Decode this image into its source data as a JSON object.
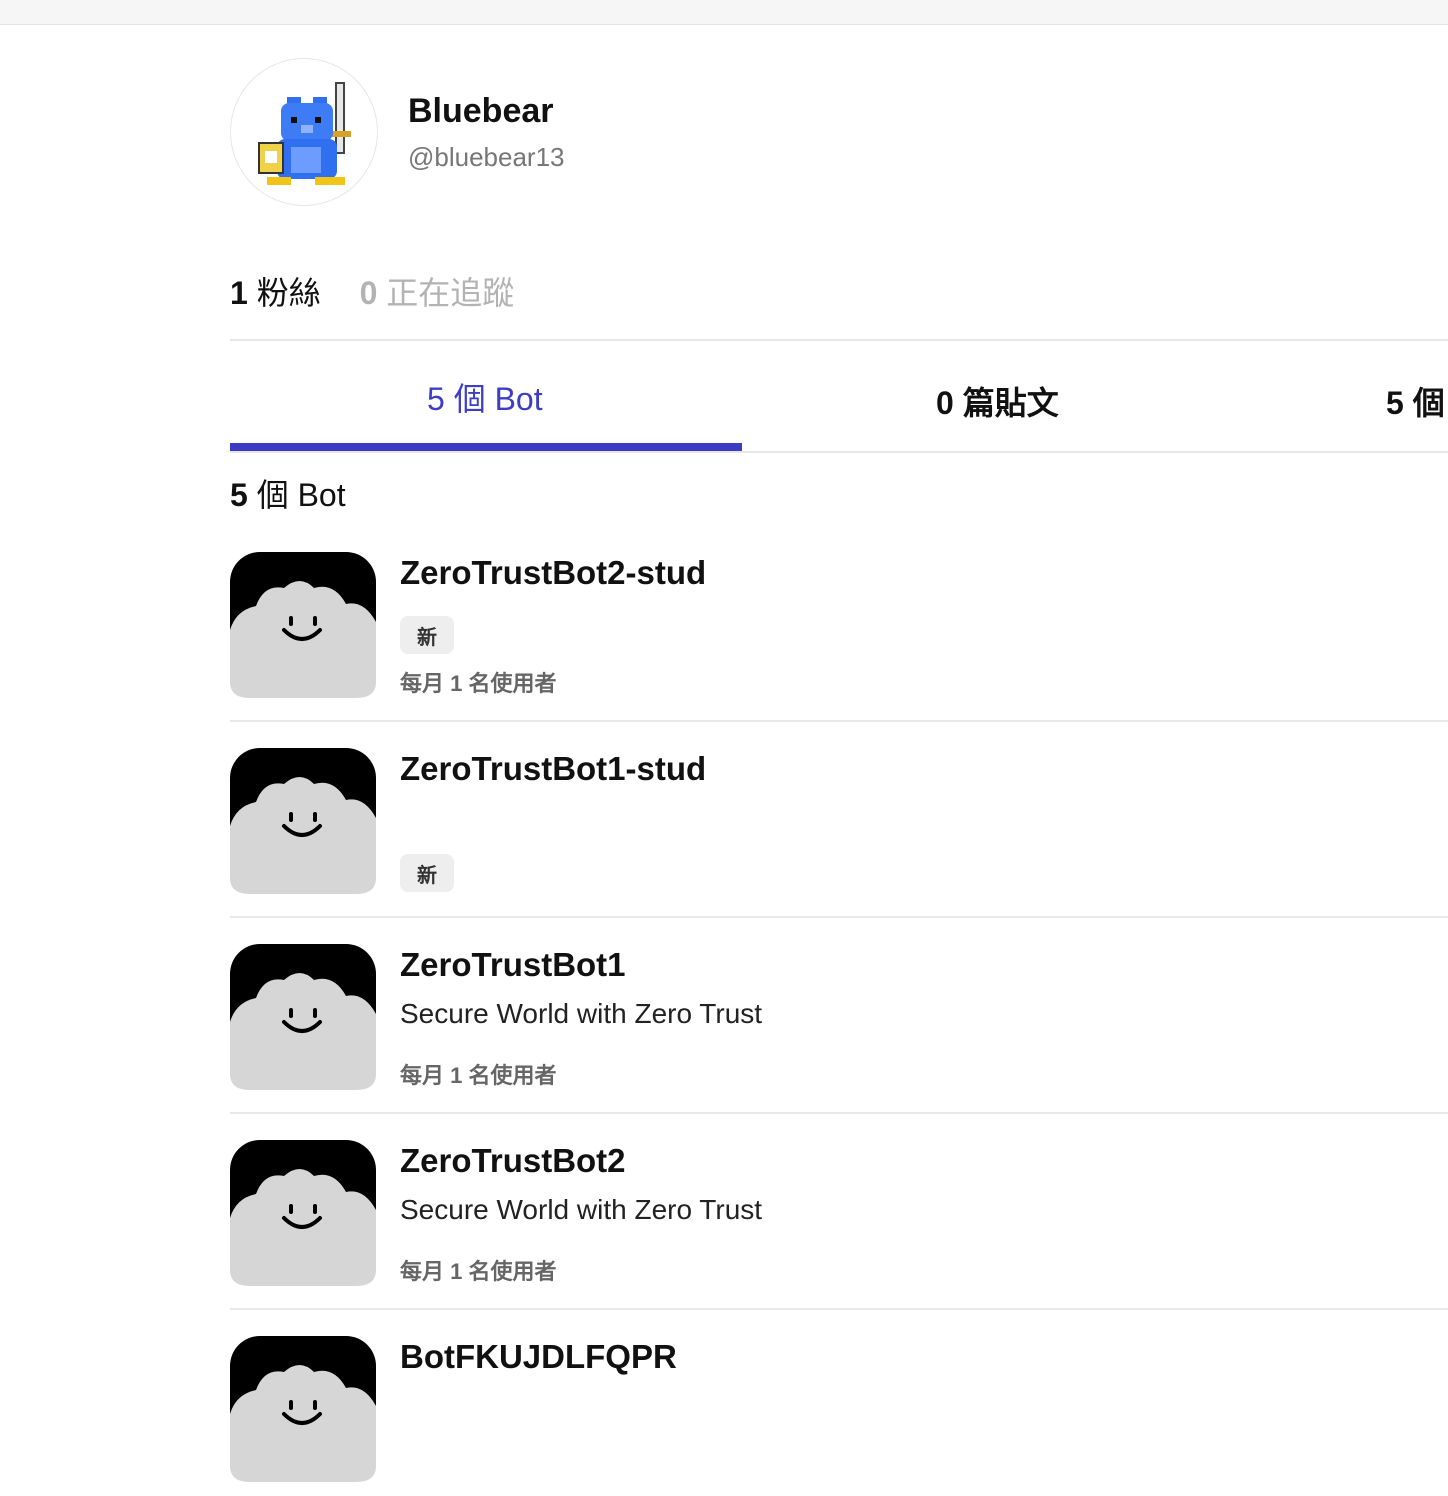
{
  "profile": {
    "name": "Bluebear",
    "handle": "@bluebear13",
    "followers_count": "1",
    "followers_label": "粉絲",
    "following_count": "0",
    "following_label": "正在追蹤"
  },
  "tabs": [
    {
      "label": "5 個 Bot",
      "active": true
    },
    {
      "label": "0 篇貼文",
      "active": false
    },
    {
      "label": "5 個",
      "active": false
    }
  ],
  "section": {
    "count": "5",
    "label": "個 Bot"
  },
  "bots": [
    {
      "name": "ZeroTrustBot2-stud",
      "badge": "新",
      "users": "每月 1 名使用者"
    },
    {
      "name": "ZeroTrustBot1-stud",
      "badge": "新"
    },
    {
      "name": "ZeroTrustBot1",
      "description": "Secure World with Zero Trust",
      "users": "每月 1 名使用者"
    },
    {
      "name": "ZeroTrustBot2",
      "description": "Secure World with Zero Trust",
      "users": "每月 1 名使用者"
    },
    {
      "name": "BotFKUJDLFQPR"
    }
  ],
  "colors": {
    "accent": "#3b3bc4",
    "muted": "#b3b3b3",
    "avatar_face": "#d6d6d6"
  },
  "icons": {
    "profile_avatar": "blue-bear-knight-icon",
    "bot_avatar": "smiling-cloud-icon"
  }
}
